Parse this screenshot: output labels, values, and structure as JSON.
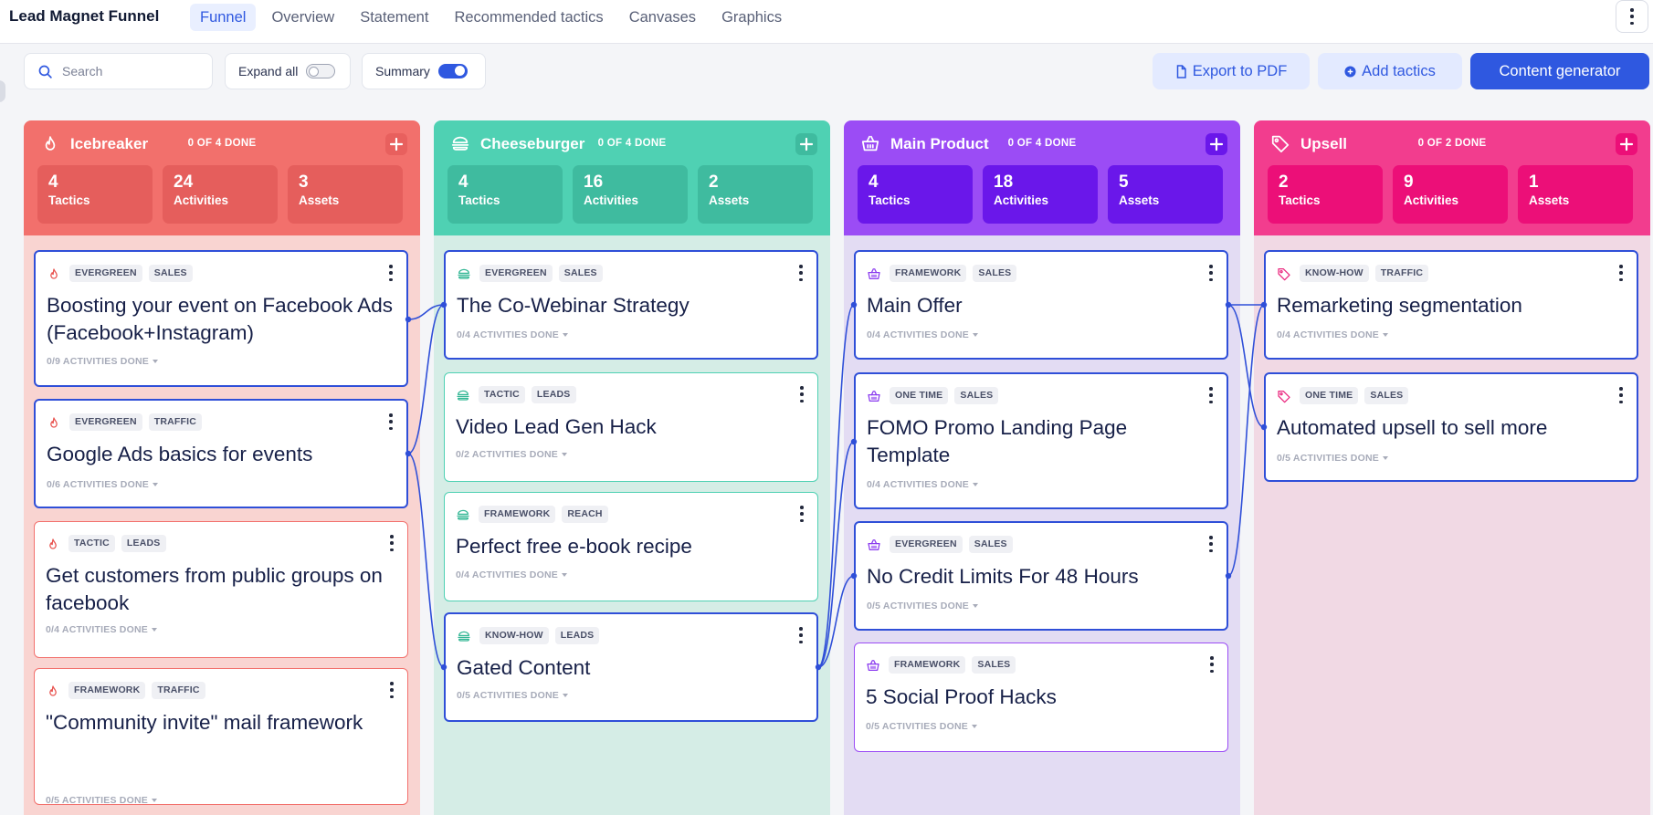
{
  "app": {
    "title": "Lead Magnet Funnel"
  },
  "tabs": [
    {
      "label": "Funnel",
      "active": true
    },
    {
      "label": "Overview"
    },
    {
      "label": "Statement"
    },
    {
      "label": "Recommended tactics"
    },
    {
      "label": "Canvases"
    },
    {
      "label": "Graphics"
    }
  ],
  "toolbar": {
    "search_placeholder": "Search",
    "expand_all_label": "Expand all",
    "expand_all_on": false,
    "summary_label": "Summary",
    "summary_on": true,
    "export_label": "Export to PDF",
    "add_tactics_label": "Add tactics",
    "content_generator_label": "Content generator"
  },
  "colors": {
    "accent": "#2f58e0",
    "card_border": "#2f4fd8"
  },
  "columns": [
    {
      "title": "Icebreaker",
      "icon": "flame-icon",
      "done": "0 OF 4 DONE",
      "head_color": "#f2706c",
      "stat_color": "#e55e5c",
      "body_color": "#f9d4d1",
      "add_color": "#e85b59",
      "tag_icon_color": "#e8534f",
      "stats": {
        "tactics": "4",
        "tactics_label": "Tactics",
        "activities": "24",
        "activities_label": "Activities",
        "assets": "3",
        "assets_label": "Assets"
      },
      "cards": [
        {
          "tags": [
            "EVERGREEN",
            "SALES"
          ],
          "title": "Boosting your event on Facebook Ads (Facebook+Instagram)",
          "progress": "0/9 ACTIVITIES DONE",
          "linked": true
        },
        {
          "tags": [
            "EVERGREEN",
            "TRAFFIC"
          ],
          "title": "Google Ads basics for events",
          "progress": "0/6 ACTIVITIES DONE",
          "linked": true
        },
        {
          "tags": [
            "TACTIC",
            "LEADS"
          ],
          "title": "Get customers from public groups on facebook",
          "progress": "0/4 ACTIVITIES DONE",
          "linked": false
        },
        {
          "tags": [
            "FRAMEWORK",
            "TRAFFIC"
          ],
          "title": "\"Community invite\" mail framework",
          "progress": "0/5 ACTIVITIES DONE",
          "linked": false
        }
      ]
    },
    {
      "title": "Cheeseburger",
      "icon": "burger-icon",
      "done": "0 OF 4 DONE",
      "head_color": "#4fd1b3",
      "stat_color": "#3fbb9f",
      "body_color": "#d5ede6",
      "add_color": "#3fbb9f",
      "tag_icon_color": "#33b795",
      "stats": {
        "tactics": "4",
        "tactics_label": "Tactics",
        "activities": "16",
        "activities_label": "Activities",
        "assets": "2",
        "assets_label": "Assets"
      },
      "cards": [
        {
          "tags": [
            "EVERGREEN",
            "SALES"
          ],
          "title": "The Co-Webinar Strategy",
          "progress": "0/4 ACTIVITIES DONE",
          "linked": true
        },
        {
          "tags": [
            "TACTIC",
            "LEADS"
          ],
          "title": "Video Lead Gen Hack",
          "progress": "0/2 ACTIVITIES DONE",
          "linked": false
        },
        {
          "tags": [
            "FRAMEWORK",
            "REACH"
          ],
          "title": "Perfect free e-book recipe",
          "progress": "0/4 ACTIVITIES DONE",
          "linked": false
        },
        {
          "tags": [
            "KNOW-HOW",
            "LEADS"
          ],
          "title": "Gated Content",
          "progress": "0/5 ACTIVITIES DONE",
          "linked": true
        }
      ]
    },
    {
      "title": "Main Product",
      "icon": "basket-icon",
      "done": "0 OF 4 DONE",
      "head_color": "#9b4cf5",
      "stat_color": "#6a17ea",
      "body_color": "#e3dcf3",
      "add_color": "#6a17ea",
      "tag_icon_color": "#8a3bef",
      "stats": {
        "tactics": "4",
        "tactics_label": "Tactics",
        "activities": "18",
        "activities_label": "Activities",
        "assets": "5",
        "assets_label": "Assets"
      },
      "cards": [
        {
          "tags": [
            "FRAMEWORK",
            "SALES"
          ],
          "title": "Main Offer",
          "progress": "0/4 ACTIVITIES DONE",
          "linked": true
        },
        {
          "tags": [
            "ONE TIME",
            "SALES"
          ],
          "title": "FOMO Promo Landing Page Template",
          "progress": "0/4 ACTIVITIES DONE",
          "linked": true
        },
        {
          "tags": [
            "EVERGREEN",
            "SALES"
          ],
          "title": "No Credit Limits For 48 Hours",
          "progress": "0/5 ACTIVITIES DONE",
          "linked": true
        },
        {
          "tags": [
            "FRAMEWORK",
            "SALES"
          ],
          "title": "5 Social Proof Hacks",
          "progress": "0/5 ACTIVITIES DONE",
          "linked": false
        }
      ]
    },
    {
      "title": "Upsell",
      "icon": "tag-icon",
      "done": "0 OF 2 DONE",
      "head_color": "#f23d8e",
      "stat_color": "#ec0f78",
      "body_color": "#f1d9e4",
      "add_color": "#ec0f78",
      "tag_icon_color": "#ea2a80",
      "stats": {
        "tactics": "2",
        "tactics_label": "Tactics",
        "activities": "9",
        "activities_label": "Activities",
        "assets": "1",
        "assets_label": "Assets"
      },
      "cards": [
        {
          "tags": [
            "KNOW-HOW",
            "TRAFFIC"
          ],
          "title": "Remarketing segmentation",
          "progress": "0/4 ACTIVITIES DONE",
          "linked": true
        },
        {
          "tags": [
            "ONE TIME",
            "SALES"
          ],
          "title": "Automated upsell to sell more",
          "progress": "0/5 ACTIVITIES DONE",
          "linked": true
        }
      ]
    }
  ]
}
